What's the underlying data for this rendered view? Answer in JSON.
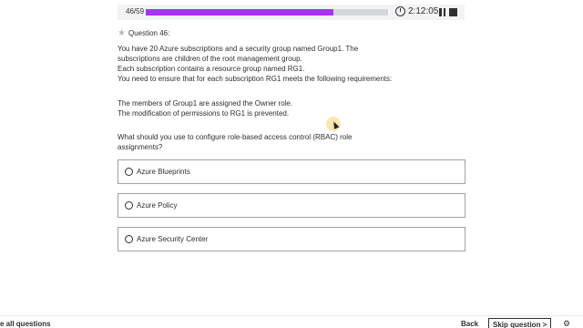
{
  "progress": {
    "counter": "46/59",
    "fraction": 0.775
  },
  "timer": {
    "value": "2:12:05"
  },
  "question": {
    "heading": "Question 46:",
    "lines": [
      "You have 20 Azure subscriptions and a security group named Group1. The",
      "subscriptions are children of the root management group.",
      "Each subscription contains a resource group named RG1.",
      "You need to ensure that for each subscription RG1 meets the following requirements:"
    ],
    "requirements": [
      "The members of Group1 are assigned the Owner role.",
      "The modification of permissions to RG1 is prevented."
    ],
    "prompt_lines": [
      "What should you use to configure role-based access control (RBAC) role",
      "assignments?"
    ]
  },
  "options": [
    {
      "label": "Azure Blueprints"
    },
    {
      "label": "Azure Policy"
    },
    {
      "label": "Azure Security Center"
    }
  ],
  "footer": {
    "all_questions": "e all questions",
    "back": "Back",
    "skip": "Skip question >"
  },
  "icons": [
    "timer-icon",
    "pause-icon",
    "stop-icon",
    "star-icon",
    "gear-icon"
  ],
  "colors": {
    "accent": "#a435f0",
    "track": "#d1d7dc"
  }
}
